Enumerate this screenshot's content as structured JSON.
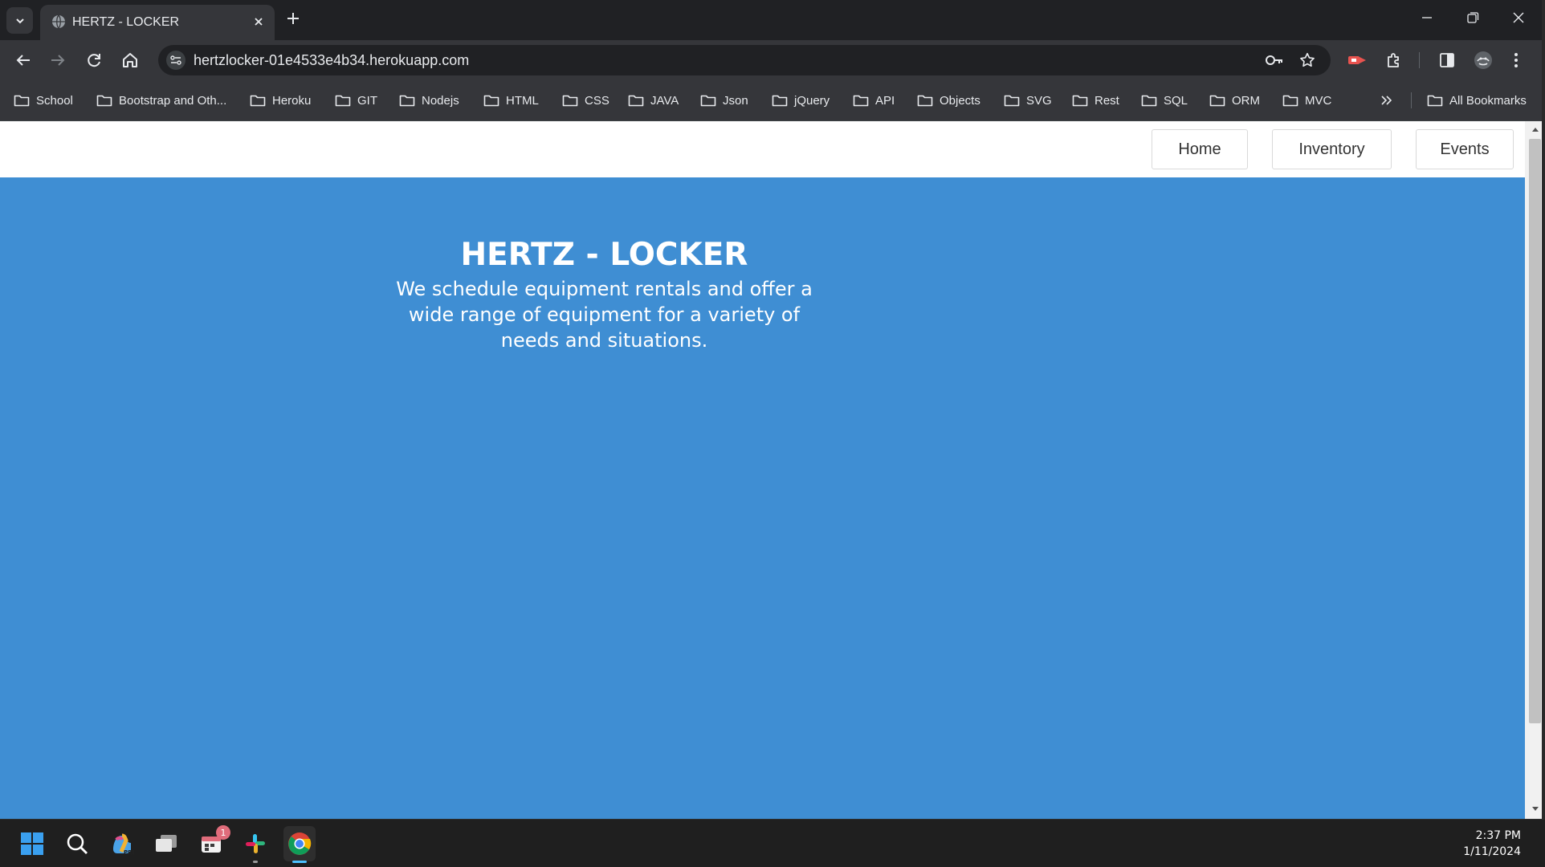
{
  "browser": {
    "tab_title": "HERTZ - LOCKER",
    "url": "hertzlocker-01e4533e4b34.herokuapp.com"
  },
  "bookmarks": [
    {
      "label": "School"
    },
    {
      "label": "Bootstrap and Oth..."
    },
    {
      "label": "Heroku"
    },
    {
      "label": "GIT"
    },
    {
      "label": "Nodejs"
    },
    {
      "label": "HTML"
    },
    {
      "label": "CSS"
    },
    {
      "label": "JAVA"
    },
    {
      "label": "Json"
    },
    {
      "label": "jQuery"
    },
    {
      "label": "API"
    },
    {
      "label": "Objects"
    },
    {
      "label": "SVG"
    },
    {
      "label": "Rest"
    },
    {
      "label": "SQL"
    },
    {
      "label": "ORM"
    },
    {
      "label": "MVC"
    }
  ],
  "all_bookmarks_label": "All Bookmarks",
  "page": {
    "nav": {
      "home": "Home",
      "inventory": "Inventory",
      "events": "Events"
    },
    "hero": {
      "title": "HERTZ - LOCKER",
      "description": "We schedule equipment rentals and offer a wide range of equipment for a variety of needs and situations."
    }
  },
  "taskbar": {
    "notification_count": "1",
    "time": "2:37 PM",
    "date": "1/11/2024"
  },
  "colors": {
    "page_background": "#3f8ed3",
    "header_background": "#ffffff",
    "browser_frame": "#202124",
    "toolbar": "#35363a"
  }
}
